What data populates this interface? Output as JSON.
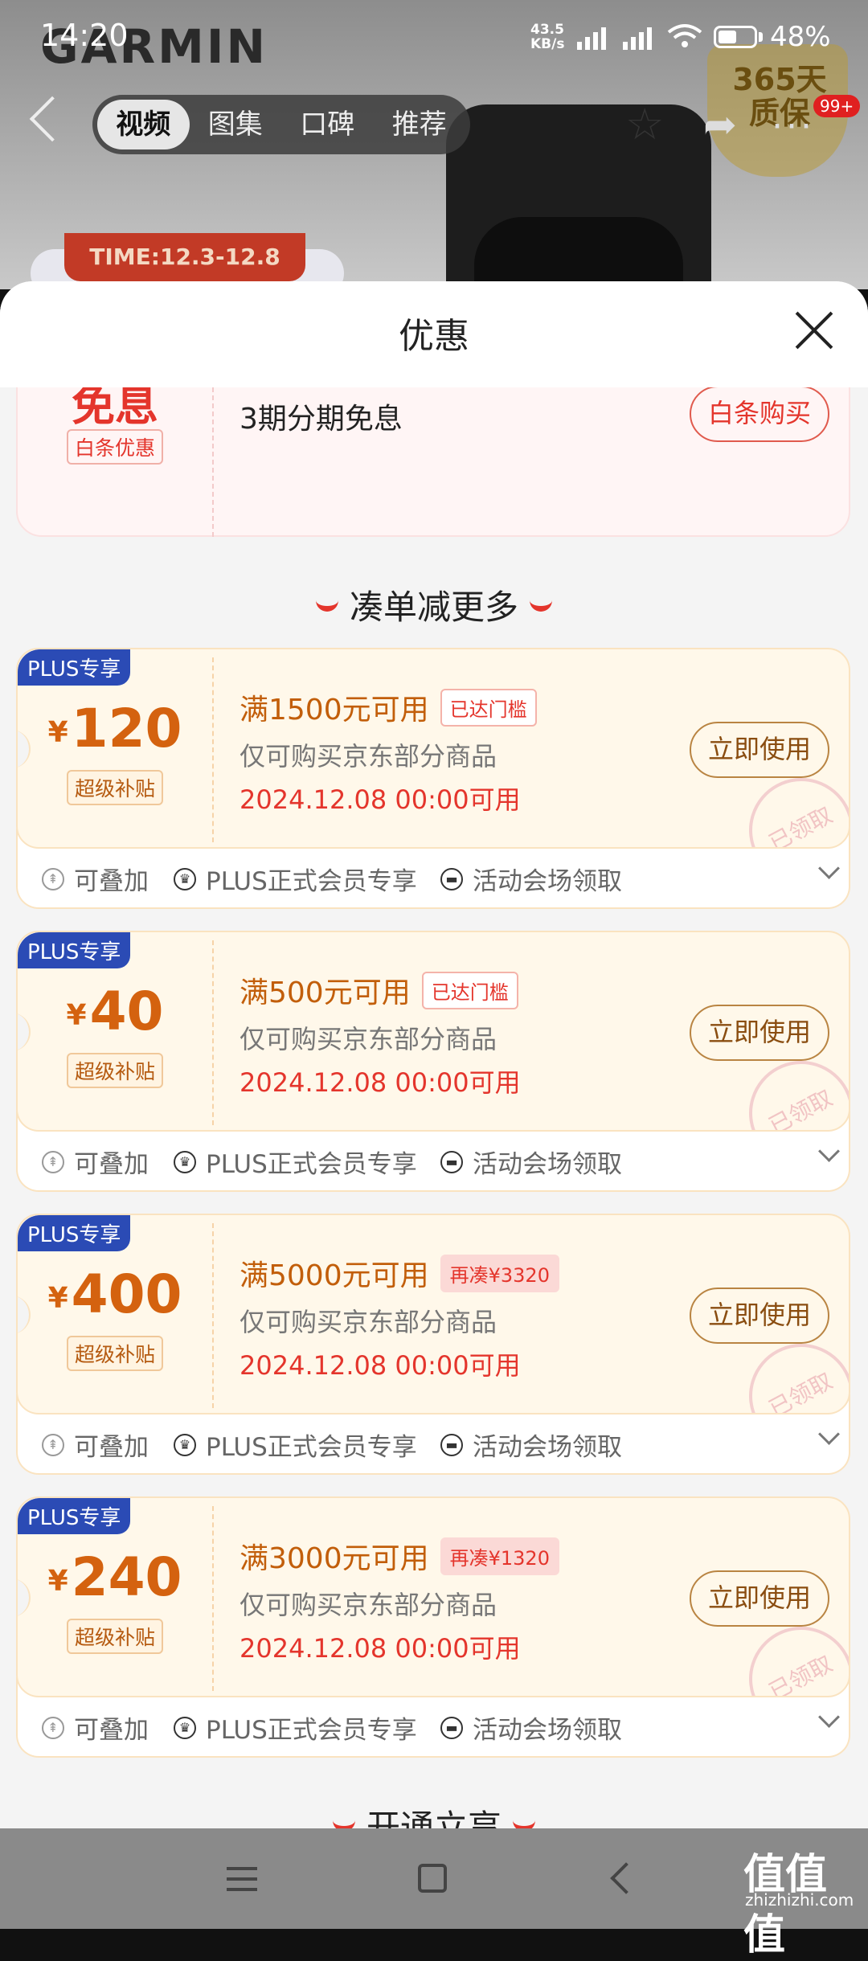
{
  "status_bar": {
    "time": "14:20",
    "net_speed_top": "43.5",
    "net_speed_bottom": "KB/s",
    "battery": "48%"
  },
  "background_page": {
    "brand": "GARMIN",
    "tabs": [
      {
        "label": "视频",
        "active": true
      },
      {
        "label": "图集"
      },
      {
        "label": "口碑"
      },
      {
        "label": "推荐"
      }
    ],
    "badge": "99+",
    "warranty_line1": "365天",
    "warranty_line2": "质保",
    "promo_time": "TIME:12.3-12.8"
  },
  "sheet": {
    "title": "优惠",
    "baitiao": {
      "headline": "免息",
      "tag": "白条优惠",
      "desc": "3期分期免息",
      "button": "白条购买"
    },
    "section_title": "凑单减更多",
    "coupons": [
      {
        "badge": "PLUS专享",
        "currency": "¥",
        "amount": "120",
        "subsidy": "超级补贴",
        "threshold": "满1500元可用",
        "tag": "已达门槛",
        "tag_type": "reached",
        "scope": "仅可购买京东部分商品",
        "valid": "2024.12.08 00:00可用",
        "button": "立即使用",
        "stamp": "已领取"
      },
      {
        "badge": "PLUS专享",
        "currency": "¥",
        "amount": "40",
        "subsidy": "超级补贴",
        "threshold": "满500元可用",
        "tag": "已达门槛",
        "tag_type": "reached",
        "scope": "仅可购买京东部分商品",
        "valid": "2024.12.08 00:00可用",
        "button": "立即使用",
        "stamp": "已领取"
      },
      {
        "badge": "PLUS专享",
        "currency": "¥",
        "amount": "400",
        "subsidy": "超级补贴",
        "threshold": "满5000元可用",
        "tag": "再凑¥3320",
        "tag_type": "more",
        "scope": "仅可购买京东部分商品",
        "valid": "2024.12.08 00:00可用",
        "button": "立即使用",
        "stamp": "已领取"
      },
      {
        "badge": "PLUS专享",
        "currency": "¥",
        "amount": "240",
        "subsidy": "超级补贴",
        "threshold": "满3000元可用",
        "tag": "再凑¥1320",
        "tag_type": "more",
        "scope": "仅可购买京东部分商品",
        "valid": "2024.12.08 00:00可用",
        "button": "立即使用",
        "stamp": "已领取"
      }
    ],
    "features": {
      "stackable": "可叠加",
      "plus_only": "PLUS正式会员专享",
      "venue": "活动会场领取"
    },
    "next_section_title": "开通立享"
  },
  "watermark": {
    "text": "值值值",
    "site": "zhizhizhi.com"
  }
}
